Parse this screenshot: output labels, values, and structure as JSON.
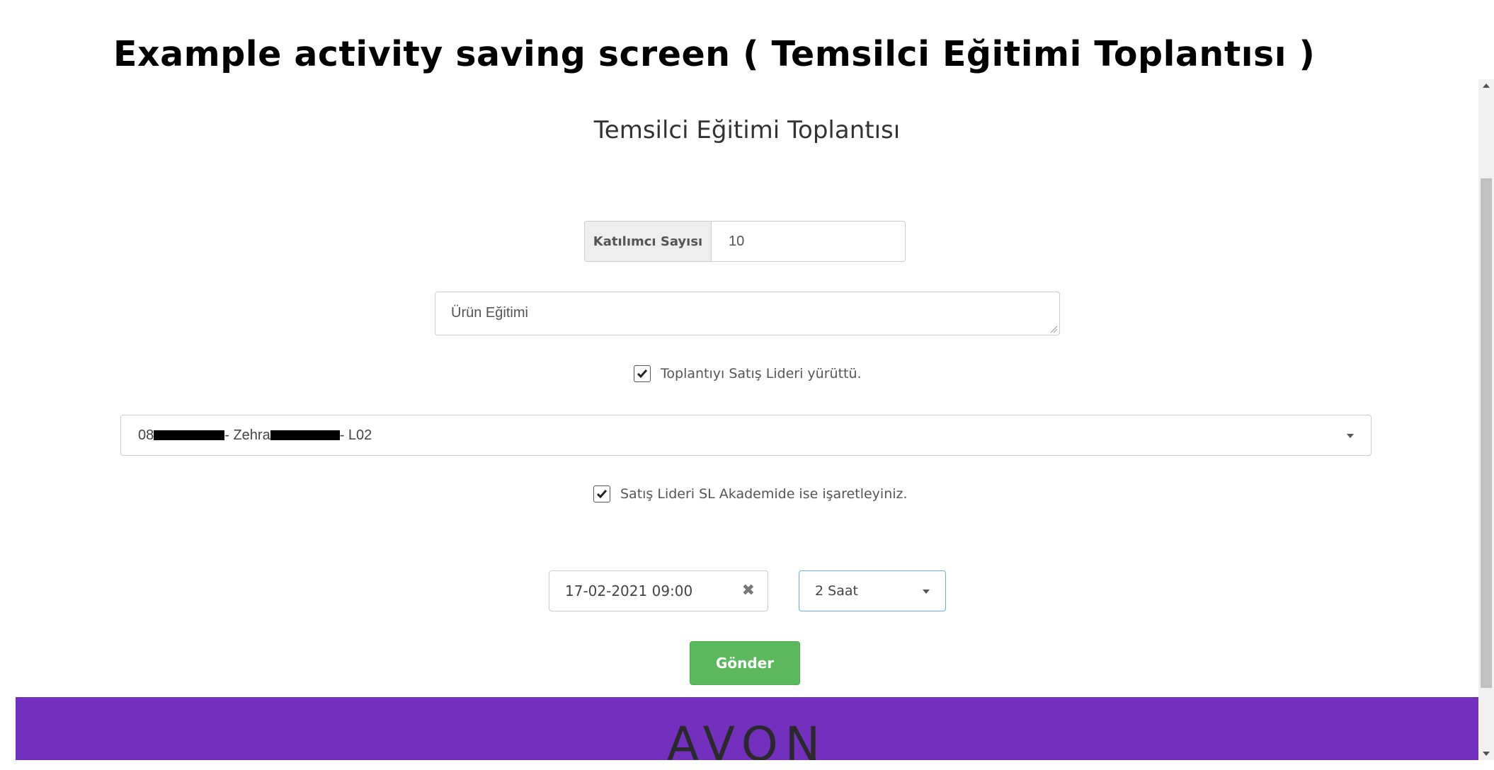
{
  "caption": "Example activity saving screen ( Temsilci Eğitimi Toplantısı )",
  "form": {
    "title": "Temsilci Eğitimi Toplantısı",
    "participants": {
      "label": "Katılımcı Sayısı",
      "value": "10"
    },
    "topic": {
      "value": "Ürün Eğitimi"
    },
    "led_by_sales_leader": {
      "checked": true,
      "label": "Toplantıyı Satış Lideri yürüttü."
    },
    "sales_leader_select": {
      "prefix": "08",
      "middle": "- Zehra",
      "suffix": "- L02"
    },
    "sl_academy": {
      "checked": true,
      "label": "Satış Lideri SL Akademide ise işaretleyiniz."
    },
    "datetime": {
      "value": "17-02-2021 09:00"
    },
    "duration": {
      "value": "2 Saat"
    },
    "submit_label": "Gönder"
  },
  "footer": {
    "brand": "AVON",
    "color": "#7330bf"
  },
  "colors": {
    "submit": "#5cb85c",
    "focus_border": "#66afe9"
  },
  "icons": {
    "checkbox": "check-icon",
    "clear": "close-icon",
    "dropdown": "caret-down-icon"
  }
}
